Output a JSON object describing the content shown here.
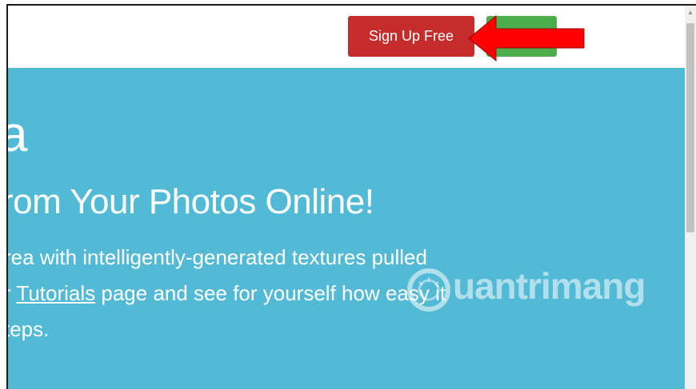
{
  "topbar": {
    "signup_label": "Sign Up Free",
    "login_label": ""
  },
  "hero": {
    "title": "a",
    "subtitle": "rom Your Photos Online!",
    "line1": "rea with intelligently-generated textures pulled",
    "line2_prefix": "r ",
    "line2_link": "Tutorials",
    "line2_suffix": " page and see for yourself how easy it",
    "line3": "teps."
  },
  "watermark": {
    "text": "uantrimang"
  },
  "colors": {
    "signup": "#c62c2c",
    "login": "#4cae4c",
    "hero_bg": "#53bad6",
    "arrow": "#ff0000"
  },
  "icons": {
    "arrow": "arrow-left-icon",
    "scroll_up": "chevron-up-icon"
  }
}
